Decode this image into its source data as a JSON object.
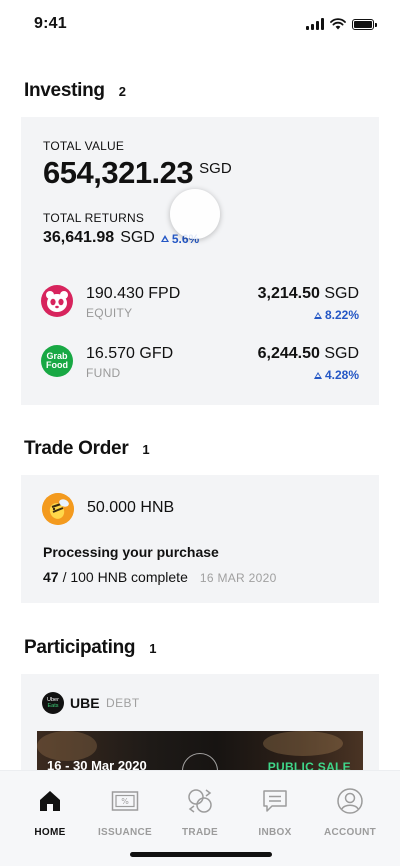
{
  "status_bar": {
    "time": "9:41"
  },
  "investing": {
    "title": "Investing",
    "count": "2",
    "total_value_label": "TOTAL VALUE",
    "total_value": "654,321.23",
    "total_value_currency": "SGD",
    "total_returns_label": "TOTAL RETURNS",
    "total_returns": "36,641.98",
    "total_returns_currency": "SGD",
    "total_returns_change": "5.6%",
    "holdings": [
      {
        "quantity": "190.430 FPD",
        "type": "EQUITY",
        "amount": "3,214.50",
        "currency": "SGD",
        "change": "8.22%",
        "logo": "foodpanda-logo",
        "logo_color": "#d7245d"
      },
      {
        "quantity": "16.570 GFD",
        "type": "FUND",
        "amount": "6,244.50",
        "currency": "SGD",
        "change": "4.28%",
        "logo": "grabfood-logo",
        "logo_text_1": "Grab",
        "logo_text_2": "Food",
        "logo_color": "#18a844"
      }
    ]
  },
  "trade_order": {
    "title": "Trade Order",
    "count": "1",
    "quantity": "50.000 HNB",
    "status": "Processing your purchase",
    "progress_done": "47",
    "progress_rest": "/ 100 HNB complete",
    "date": "16 MAR 2020",
    "logo": "honestbee-logo"
  },
  "participating": {
    "title": "Participating",
    "count": "1",
    "name": "UBE",
    "type": "DEBT",
    "logo_text_1": "Uber",
    "logo_text_2": "Eats",
    "banner_dates": "16 - 30 Mar 2020",
    "banner_status": "PUBLIC SALE"
  },
  "bottom_nav": [
    {
      "label": "HOME",
      "icon": "home-icon",
      "active": true
    },
    {
      "label": "ISSUANCE",
      "icon": "issuance-icon",
      "active": false
    },
    {
      "label": "TRADE",
      "icon": "trade-icon",
      "active": false
    },
    {
      "label": "INBOX",
      "icon": "inbox-icon",
      "active": false
    },
    {
      "label": "ACCOUNT",
      "icon": "account-icon",
      "active": false
    }
  ],
  "colors": {
    "accent_blue": "#2457c5",
    "card_bg": "#f3f4f6",
    "public_sale_green": "#3fd68a"
  }
}
